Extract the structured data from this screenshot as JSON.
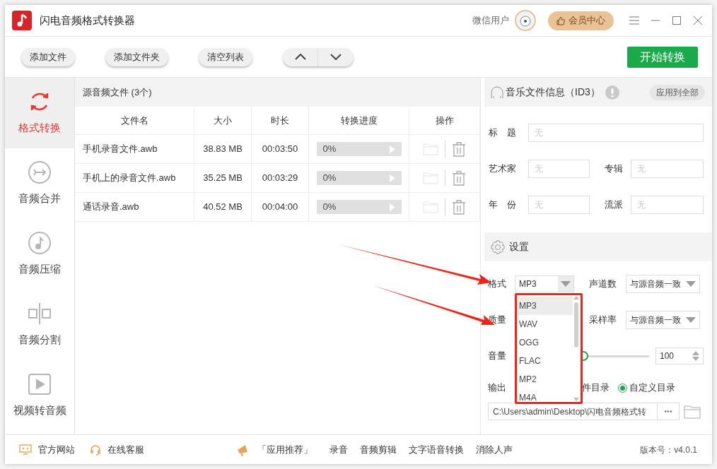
{
  "window": {
    "title": "闪电音频格式转换器",
    "user": "微信用户",
    "vip_button": "会员中心"
  },
  "toolbar": {
    "buttons": [
      "添加文件",
      "添加文件夹",
      "清空列表"
    ],
    "start_button": "开始转换"
  },
  "sidebar": {
    "items": [
      {
        "label": "格式转换",
        "kind": "convert",
        "selected": true
      },
      {
        "label": "音频合并",
        "kind": "merge",
        "selected": false
      },
      {
        "label": "音频压缩",
        "kind": "compress",
        "selected": false
      },
      {
        "label": "音频分割",
        "kind": "split",
        "selected": false
      },
      {
        "label": "视频转音频",
        "kind": "video",
        "selected": false
      }
    ]
  },
  "file_list": {
    "title": "源音频文件 (3个)",
    "columns": [
      "文件名",
      "大小",
      "时长",
      "转换进度",
      "操作"
    ],
    "rows": [
      {
        "name": "手机录音文件.awb",
        "size": "38.83 MB",
        "duration": "00:03:50",
        "progress": "0%",
        "level": 0
      },
      {
        "name": "手机上的录音文件.awb",
        "size": "35.25 MB",
        "duration": "00:03:29",
        "progress": "0%",
        "level": 0
      },
      {
        "name": "通话录音.awb",
        "size": "40.52 MB",
        "duration": "00:04:00",
        "progress": "0%",
        "level": 0
      }
    ]
  },
  "id3": {
    "title": "音乐文件信息（ID3）",
    "apply_button": "应用到全部",
    "fields": [
      {
        "label": "标　题",
        "placeholder": "无"
      },
      {
        "label": "艺术家",
        "placeholder": "无"
      },
      {
        "label": "专辑",
        "placeholder": "无"
      },
      {
        "label": "年　份",
        "placeholder": "无"
      },
      {
        "label": "流派",
        "placeholder": "无"
      }
    ]
  },
  "settings": {
    "title": "设置",
    "format": {
      "label": "格式",
      "value": "MP3",
      "options": [
        {
          "label": "MP3",
          "selected": true
        },
        {
          "label": "WAV",
          "selected": false
        },
        {
          "label": "OGG",
          "selected": false
        },
        {
          "label": "FLAC",
          "selected": false
        },
        {
          "label": "MP2",
          "selected": false
        },
        {
          "label": "M4A",
          "selected": false
        }
      ]
    },
    "channels": {
      "label": "声道数",
      "value": "与源音频一致"
    },
    "quality": {
      "label": "质量"
    },
    "sample_rate": {
      "label": "采样率",
      "value": "与源音频一致"
    },
    "volume": {
      "label": "音量",
      "level": 0.46,
      "value": "100"
    },
    "output": {
      "label": "输出",
      "partial_label": "件目录",
      "radio": {
        "label": "自定义目录",
        "selected": true
      },
      "path": "C:\\Users\\admin\\Desktop\\闪电音频格式转",
      "browse": "•••"
    }
  },
  "footer": {
    "links": [
      "官方网站",
      "在线客服"
    ],
    "recommend": "「应用推荐」",
    "apps": [
      "录音",
      "音频剪辑",
      "文字语音转换",
      "消除人声"
    ],
    "version": "版本号：v4.0.1"
  }
}
